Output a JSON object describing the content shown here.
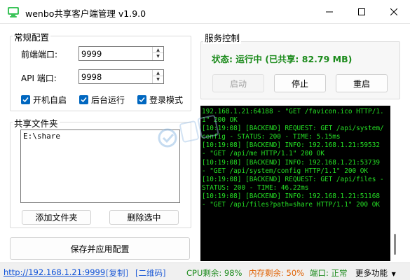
{
  "window": {
    "title": "wenbo共享客户端管理 v1.9.0"
  },
  "config": {
    "group_title": "常规配置",
    "front_port_label": "前端端口:",
    "front_port_value": "9999",
    "api_port_label": "API 端口:",
    "api_port_value": "9998",
    "checkboxes": {
      "autostart": "开机自启",
      "background": "后台运行",
      "login_mode": "登录模式"
    }
  },
  "shared_folders": {
    "group_title": "共享文件夹",
    "items": [
      "E:\\share"
    ],
    "add_button": "添加文件夹",
    "delete_button": "删除选中"
  },
  "save_button": "保存并应用配置",
  "service": {
    "group_title": "服务控制",
    "status_text": "状态: 运行中 (已共享: 82.79 MB)",
    "start_button": "启动",
    "stop_button": "停止",
    "restart_button": "重启"
  },
  "console": {
    "log": "192.168.1.21:64188 - \"GET /favicon.ico HTTP/1.1\" 200 OK\n[10:19:08] [BACKEND] REQUEST: GET /api/system/config - STATUS: 200 - TIME: 5.15ms\n[10:19:08] [BACKEND] INFO: 192.168.1.21:59532 - \"GET /api/me HTTP/1.1\" 200 OK\n[10:19:08] [BACKEND] INFO: 192.168.1.21:53739 - \"GET /api/system/config HTTP/1.1\" 200 OK\n[10:19:08] [BACKEND] REQUEST: GET /api/files - STATUS: 200 - TIME: 46.22ms\n[10:19:08] [BACKEND] INFO: 192.168.1.21:51168 - \"GET /api/files?path=share HTTP/1.1\" 200 OK"
  },
  "statusbar": {
    "url": "http://192.168.1.21:9999",
    "copy": "[复制]",
    "qrcode": "[二维码]",
    "cpu": "CPU剩余: 98%",
    "memory": "内存剩余: 50%",
    "port": "端口: 正常",
    "more": "更多功能"
  },
  "colors": {
    "accent": "#0067c0",
    "status_green": "#1a8a1a",
    "memory_orange": "#e06000",
    "console_text": "#25e025"
  }
}
